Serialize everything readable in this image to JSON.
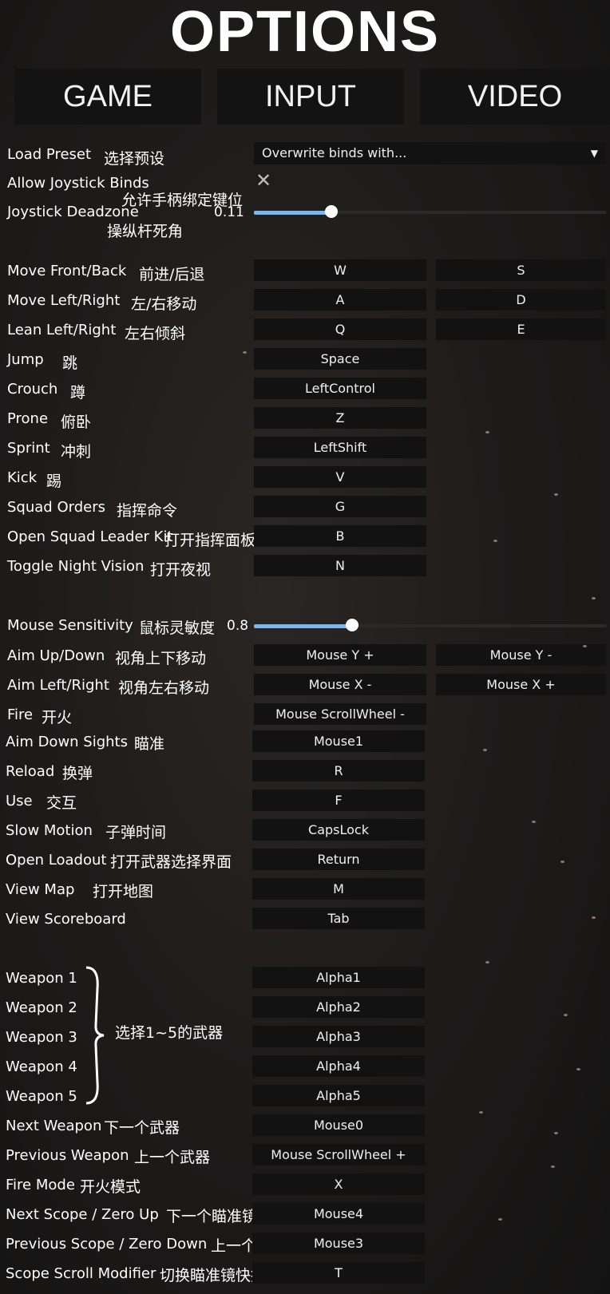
{
  "title": "OPTIONS",
  "tabs": [
    "GAME",
    "INPUT",
    "VIDEO"
  ],
  "top": {
    "load_preset": {
      "label": "Load Preset",
      "cn": "选择预设",
      "select_value": "Overwrite binds with..."
    },
    "joystick_binds": {
      "label": "Allow Joystick Binds",
      "cn": "允许手柄绑定键位",
      "checked": false
    },
    "deadzone": {
      "label": "Joystick Deadzone",
      "cn": "操纵杆死角",
      "value": "0.11"
    }
  },
  "move_binds": [
    {
      "label": "Move Front/Back",
      "cn": "前进/后退",
      "primary": "W",
      "secondary": "S"
    },
    {
      "label": "Move Left/Right",
      "cn": "左/右移动",
      "primary": "A",
      "secondary": "D"
    },
    {
      "label": "Lean Left/Right",
      "cn": "左右倾斜",
      "primary": "Q",
      "secondary": "E"
    },
    {
      "label": "Jump",
      "cn": "跳",
      "primary": "Space",
      "secondary": ""
    },
    {
      "label": "Crouch",
      "cn": "蹲",
      "primary": "LeftControl",
      "secondary": ""
    },
    {
      "label": "Prone",
      "cn": "俯卧",
      "primary": "Z",
      "secondary": ""
    },
    {
      "label": "Sprint",
      "cn": "冲刺",
      "primary": "LeftShift",
      "secondary": ""
    },
    {
      "label": "Kick",
      "cn": "踢",
      "primary": "V",
      "secondary": ""
    },
    {
      "label": "Squad Orders",
      "cn": "指挥命令",
      "primary": "G",
      "secondary": ""
    },
    {
      "label": "Open Squad Leader Kit",
      "cn": "打开指挥面板",
      "primary": "B",
      "secondary": ""
    },
    {
      "label": "Toggle Night Vision",
      "cn": "打开夜视",
      "primary": "N",
      "secondary": ""
    }
  ],
  "mouse": {
    "label": "Mouse Sensitivity",
    "cn": "鼠标灵敏度",
    "value": "0.8"
  },
  "aim_binds": [
    {
      "label": "Aim Up/Down",
      "cn": "视角上下移动",
      "primary": "Mouse Y +",
      "secondary": "Mouse Y -"
    },
    {
      "label": "Aim Left/Right",
      "cn": "视角左右移动",
      "primary": "Mouse X -",
      "secondary": "Mouse X +"
    },
    {
      "label": "Fire",
      "cn": "开火",
      "primary": "Mouse ScrollWheel -",
      "secondary": ""
    }
  ],
  "action_binds": [
    {
      "label": "Aim Down Sights",
      "cn": "瞄准",
      "primary": "Mouse1"
    },
    {
      "label": "Reload",
      "cn": "换弹",
      "primary": "R"
    },
    {
      "label": "Use",
      "cn": "交互",
      "primary": "F"
    },
    {
      "label": "Slow Motion",
      "cn": "子弹时间",
      "primary": "CapsLock"
    },
    {
      "label": "Open Loadout",
      "cn": "打开武器选择界面",
      "primary": "Return"
    },
    {
      "label": "View Map",
      "cn": "打开地图",
      "primary": "M"
    },
    {
      "label": "View Scoreboard",
      "cn": "",
      "primary": "Tab"
    }
  ],
  "weapon_note": "选择1~5的武器",
  "weapon_binds": [
    {
      "label": "Weapon 1",
      "primary": "Alpha1"
    },
    {
      "label": "Weapon 2",
      "primary": "Alpha2"
    },
    {
      "label": "Weapon 3",
      "primary": "Alpha3"
    },
    {
      "label": "Weapon 4",
      "primary": "Alpha4"
    },
    {
      "label": "Weapon 5",
      "primary": "Alpha5"
    }
  ],
  "misc_binds": [
    {
      "label": "Next Weapon",
      "cn": "下一个武器",
      "primary": "Mouse0"
    },
    {
      "label": "Previous Weapon",
      "cn": "上一个武器",
      "primary": "Mouse ScrollWheel +"
    },
    {
      "label": "Fire Mode",
      "cn": "开火模式",
      "primary": "X"
    },
    {
      "label": "Next Scope / Zero Up",
      "cn": "下一个瞄准镜",
      "primary": "Mouse4"
    },
    {
      "label": "Previous Scope / Zero Down",
      "cn": "上一个瞄准镜",
      "primary": "Mouse3"
    },
    {
      "label": "Scope Scroll Modifier",
      "cn": "切换瞄准镜快捷键",
      "primary": "T"
    }
  ],
  "slider_color": "#7fb6e6",
  "mouse_sensitivity_fraction": 0.28,
  "joystick_deadzone_fraction": 0.11
}
